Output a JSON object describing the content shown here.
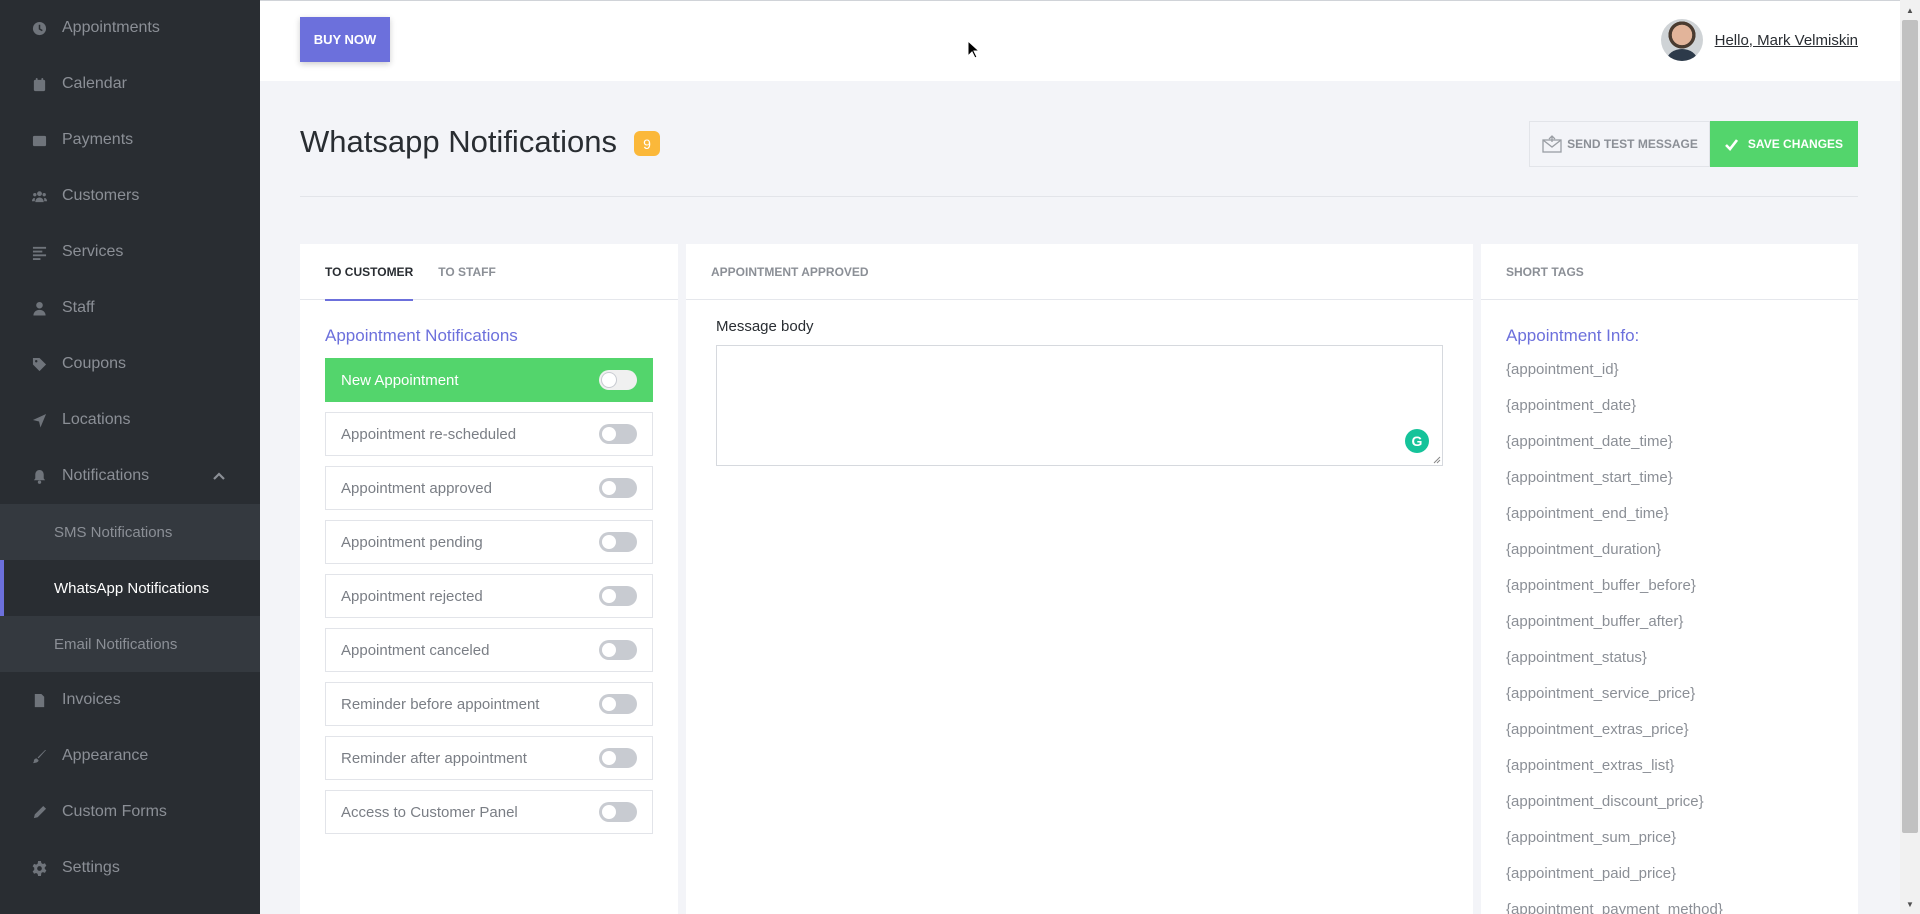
{
  "sidebar": {
    "items": [
      {
        "label": "Appointments",
        "icon": "clock-icon"
      },
      {
        "label": "Calendar",
        "icon": "calendar-icon"
      },
      {
        "label": "Payments",
        "icon": "wallet-icon"
      },
      {
        "label": "Customers",
        "icon": "users-icon"
      },
      {
        "label": "Services",
        "icon": "list-icon"
      },
      {
        "label": "Staff",
        "icon": "user-icon"
      },
      {
        "label": "Coupons",
        "icon": "tag-icon"
      },
      {
        "label": "Locations",
        "icon": "location-arrow-icon"
      },
      {
        "label": "Notifications",
        "icon": "bell-icon"
      }
    ],
    "sub_items": [
      {
        "label": "SMS Notifications"
      },
      {
        "label": "WhatsApp Notifications"
      },
      {
        "label": "Email Notifications"
      }
    ],
    "bottom_items": [
      {
        "label": "Invoices",
        "icon": "file-icon"
      },
      {
        "label": "Appearance",
        "icon": "brush-icon"
      },
      {
        "label": "Custom Forms",
        "icon": "pen-icon"
      },
      {
        "label": "Settings",
        "icon": "gear-icon"
      }
    ]
  },
  "topbar": {
    "buy_label": "BUY NOW",
    "user_name": "Hello, Mark Velmiskin"
  },
  "header": {
    "title": "Whatsapp Notifications",
    "badge": "9",
    "test_label": "SEND TEST MESSAGE",
    "save_label": "SAVE CHANGES"
  },
  "left_panel": {
    "tabs": [
      {
        "label": "TO CUSTOMER"
      },
      {
        "label": "TO STAFF"
      }
    ],
    "section_title": "Appointment Notifications",
    "notifications": [
      {
        "label": "New Appointment"
      },
      {
        "label": "Appointment re-scheduled"
      },
      {
        "label": "Appointment approved"
      },
      {
        "label": "Appointment pending"
      },
      {
        "label": "Appointment rejected"
      },
      {
        "label": "Appointment canceled"
      },
      {
        "label": "Reminder before appointment"
      },
      {
        "label": "Reminder after appointment"
      },
      {
        "label": "Access to Customer Panel"
      }
    ]
  },
  "middle_panel": {
    "header": "APPOINTMENT APPROVED",
    "message_label": "Message body",
    "message_value": ""
  },
  "right_panel": {
    "header": "SHORT TAGS",
    "section_title": "Appointment Info:",
    "tags": [
      "{appointment_id}",
      "{appointment_date}",
      "{appointment_date_time}",
      "{appointment_start_time}",
      "{appointment_end_time}",
      "{appointment_duration}",
      "{appointment_buffer_before}",
      "{appointment_buffer_after}",
      "{appointment_status}",
      "{appointment_service_price}",
      "{appointment_extras_price}",
      "{appointment_extras_list}",
      "{appointment_discount_price}",
      "{appointment_sum_price}",
      "{appointment_paid_price}",
      "{appointment_payment_method}"
    ]
  },
  "colors": {
    "accent": "#6c70dc",
    "success": "#53d56c",
    "badge": "#fbb83a",
    "sidebar": "#292d32"
  }
}
